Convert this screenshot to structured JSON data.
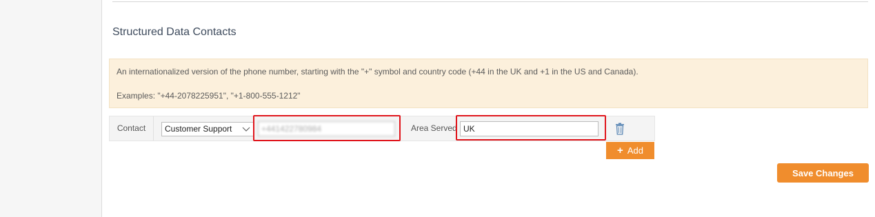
{
  "section": {
    "title": "Structured Data Contacts"
  },
  "help": {
    "line1": "An internationalized version of the phone number, starting with the \"+\" symbol and country code (+44 in the UK and +1 in the US and Canada).",
    "line2": "Examples: \"+44-2078225951\", \"+1-800-555-1212\""
  },
  "contact_row": {
    "label": "Contact",
    "contact_type": {
      "selected": "Customer Support",
      "icon": "chevron-down-icon"
    },
    "phone": {
      "value": "+441422780984",
      "blurred": true
    },
    "area_served": {
      "label": "Area Served",
      "value": "UK"
    },
    "delete_icon": "trash-icon"
  },
  "buttons": {
    "add_label": "Add",
    "add_icon": "plus-icon",
    "save_label": "Save Changes"
  },
  "colors": {
    "accent": "#f08d2d",
    "help_background": "#fcf0dc",
    "highlight": "#e0141b",
    "trash": "#5b87b5"
  }
}
